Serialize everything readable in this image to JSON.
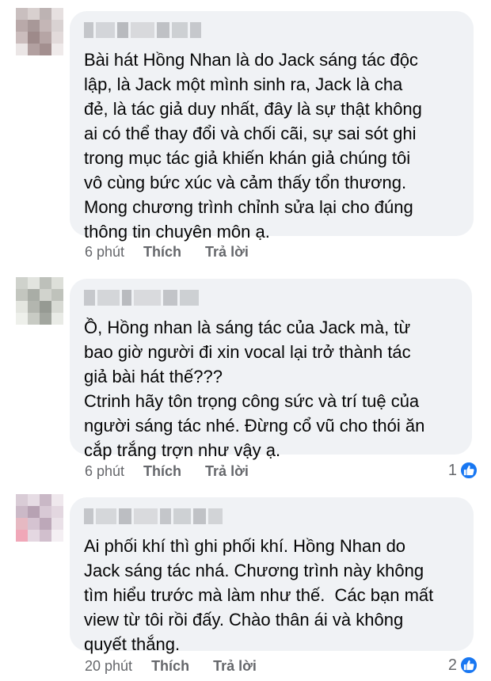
{
  "comments": [
    {
      "text": "Bài hát Hồng Nhan là do Jack sáng tác độc\nlập, là Jack một mình sinh ra, Jack là cha\nđẻ, là tác giả duy nhất, đây là sự thật không\nai có thể thay đổi và chối cãi, sự sai sót ghi\ntrong mục tác giả khiến khán giả chúng tôi\nvô cùng bức xúc và cảm thấy tổn thương.\nMong chương trình chỉnh sửa lại cho đúng\nthông tin chuyên môn ạ.",
      "time": "6 phút",
      "like_label": "Thích",
      "reply_label": "Trả lời",
      "reaction_count": ""
    },
    {
      "text": "Ồ, Hồng nhan là sáng tác của Jack mà, từ\nbao giờ người đi xin vocal lại trở thành tác\ngiả bài hát thế???\nCtrinh hãy tôn trọng công sức và trí tuệ của\nngười sáng tác nhé. Đừng cổ vũ cho thói ăn\ncắp trắng trợn như vậy ạ.",
      "time": "6 phút",
      "like_label": "Thích",
      "reply_label": "Trả lời",
      "reaction_count": "1"
    },
    {
      "text": "Ai phối khí thì ghi phối khí. Hồng Nhan do\nJack sáng tác nhá. Chương trình này không\ntìm hiểu trước mà làm như thế.  Các bạn mất\nview từ tôi rồi đấy. Chào thân ái và không\nquyết thắng.",
      "time": "20 phút",
      "like_label": "Thích",
      "reply_label": "Trả lời",
      "reaction_count": "2"
    }
  ],
  "colors": {
    "bubble": "#f0f2f5",
    "meta_text": "#65676b",
    "like_blue": "#1877f2"
  }
}
